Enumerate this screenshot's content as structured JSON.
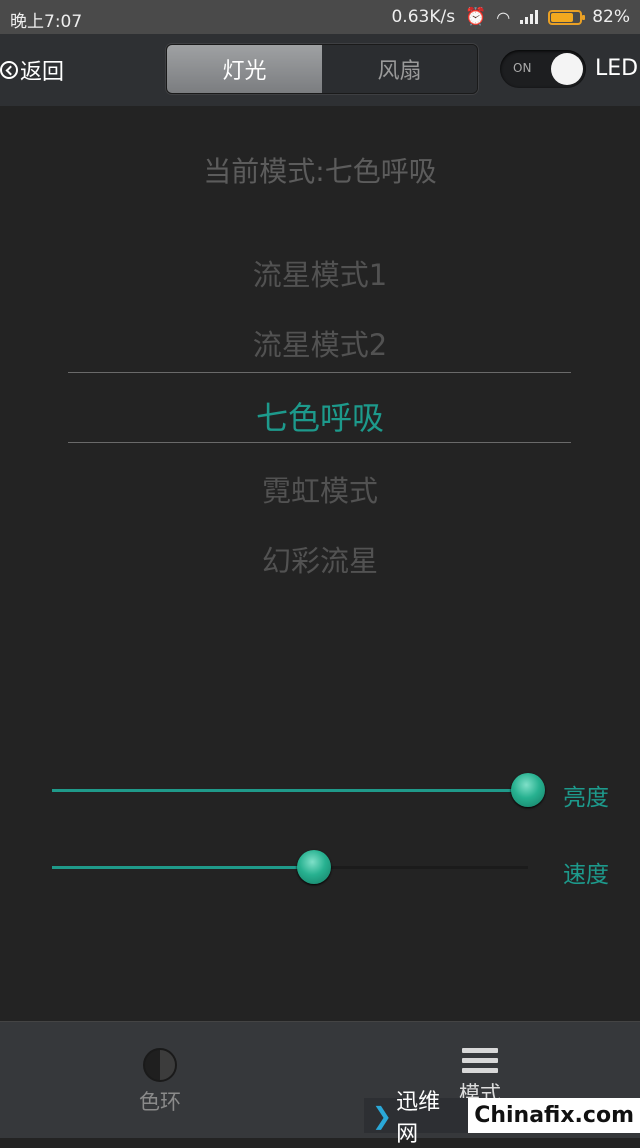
{
  "status_bar": {
    "time": "晚上7:07",
    "speed": "0.63K/s",
    "battery_percent": "82%",
    "battery_level": 0.82
  },
  "header": {
    "back_label": "返回",
    "tabs": [
      {
        "label": "灯光",
        "active": true
      },
      {
        "label": "风扇",
        "active": false
      }
    ],
    "toggle_state": "ON",
    "toggle_label": "LED"
  },
  "main": {
    "current_mode": "当前模式:七色呼吸",
    "modes": [
      "流星模式1",
      "流星模式2",
      "七色呼吸",
      "霓虹模式",
      "幻彩流星"
    ],
    "selected_mode": "七色呼吸"
  },
  "sliders": [
    {
      "label": "亮度",
      "value": 1.0
    },
    {
      "label": "速度",
      "value": 0.55
    }
  ],
  "bottom_nav": [
    {
      "label": "色环"
    },
    {
      "label": "模式"
    }
  ],
  "watermark": {
    "cn": "迅维网",
    "en": "Chinafix.com"
  },
  "colors": {
    "accent": "#1d9a8c",
    "background": "#232323",
    "battery": "#f3a91f"
  }
}
